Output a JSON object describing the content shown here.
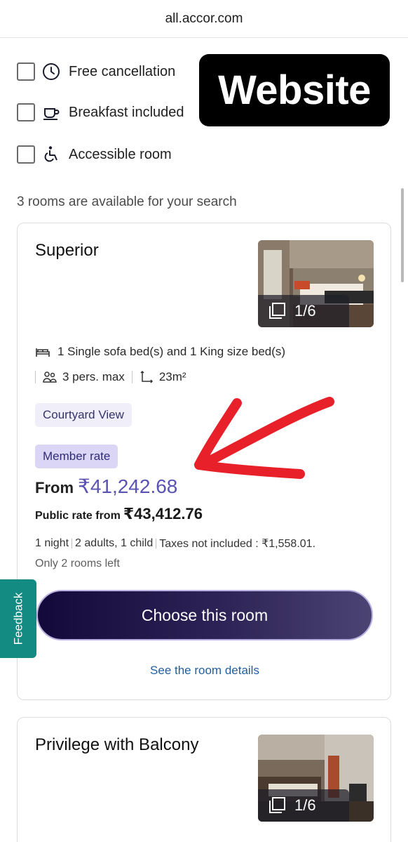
{
  "browser": {
    "url": "all.accor.com"
  },
  "filters": [
    {
      "label": "Free cancellation",
      "icon": "clock-icon",
      "checked": false
    },
    {
      "label": "Breakfast included",
      "icon": "cup-icon",
      "checked": false
    },
    {
      "label": "Accessible room",
      "icon": "wheelchair-icon",
      "checked": false
    }
  ],
  "overlay_badge": "Website",
  "results": {
    "count_text": "3 rooms are available for your search"
  },
  "rooms": [
    {
      "title": "Superior",
      "photo_counter": "1/6",
      "beds": "1 Single sofa bed(s) and 1 King size bed(s)",
      "capacity": "3 pers. max",
      "size": "23m²",
      "view_tag": "Courtyard View",
      "rate_tag": "Member rate",
      "price_from_label": "From",
      "price_from_value": "₹41,242.68",
      "public_rate_label": "Public rate from",
      "public_rate_value": "₹43,412.76",
      "nights": "1 night",
      "guests": "2 adults, 1 child",
      "taxes": "Taxes not included : ₹1,558.01.",
      "availability": "Only 2 rooms left",
      "cta_label": "Choose this room",
      "details_link": "See the room details"
    },
    {
      "title": "Privilege with Balcony",
      "photo_counter": "1/6"
    }
  ],
  "feedback_tab": "Feedback",
  "colors": {
    "accent_price": "#5a53b3",
    "cta_gradient_start": "#13093a",
    "cta_gradient_end": "#4b4473",
    "feedback": "#138a82",
    "annotation_arrow": "#e8202a",
    "link": "#1f5fa0"
  }
}
